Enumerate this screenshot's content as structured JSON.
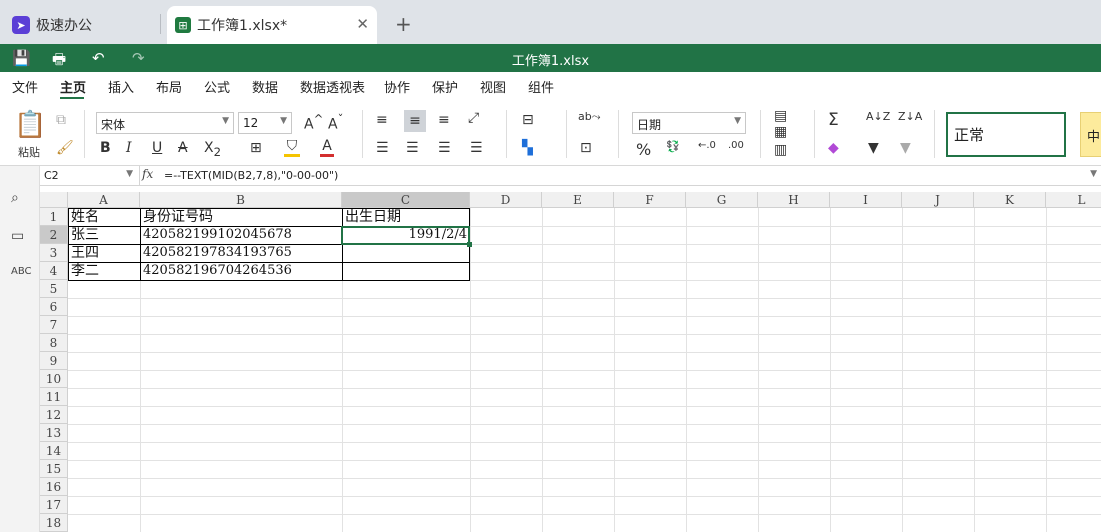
{
  "tabs": [
    {
      "label": "极速办公"
    },
    {
      "label": "工作簿1.xlsx*"
    }
  ],
  "title": "工作簿1.xlsx",
  "menu": [
    "文件",
    "主页",
    "插入",
    "布局",
    "公式",
    "数据",
    "数据透视表",
    "协作",
    "保护",
    "视图",
    "组件"
  ],
  "ribbon": {
    "paste_label": "粘贴",
    "font_name": "宋体",
    "font_size": "12",
    "number_format": "日期",
    "style_normal": "正常",
    "style_mid": "中",
    "font_color": "#d32f2f",
    "fill_color": "#f5c400"
  },
  "namebox": "C2",
  "formula": "=--TEXT(MID(B2,7,8),\"0-00-00\")",
  "columns": [
    "A",
    "B",
    "C",
    "D",
    "E",
    "F",
    "G",
    "H",
    "I",
    "J",
    "K",
    "L"
  ],
  "rows": [
    "1",
    "2",
    "3",
    "4",
    "5",
    "6",
    "7",
    "8",
    "9",
    "10",
    "11",
    "12",
    "13",
    "14",
    "15",
    "16",
    "17",
    "18"
  ],
  "cells": {
    "A1": "姓名",
    "B1": "身份证号码",
    "C1": "出生日期",
    "A2": "张三",
    "B2": "420582199102045678",
    "C2": "1991/2/4",
    "A3": "王四",
    "B3": "420582197834193765",
    "A4": "李二",
    "B4": "420582196704264536"
  },
  "accent": "#217346"
}
